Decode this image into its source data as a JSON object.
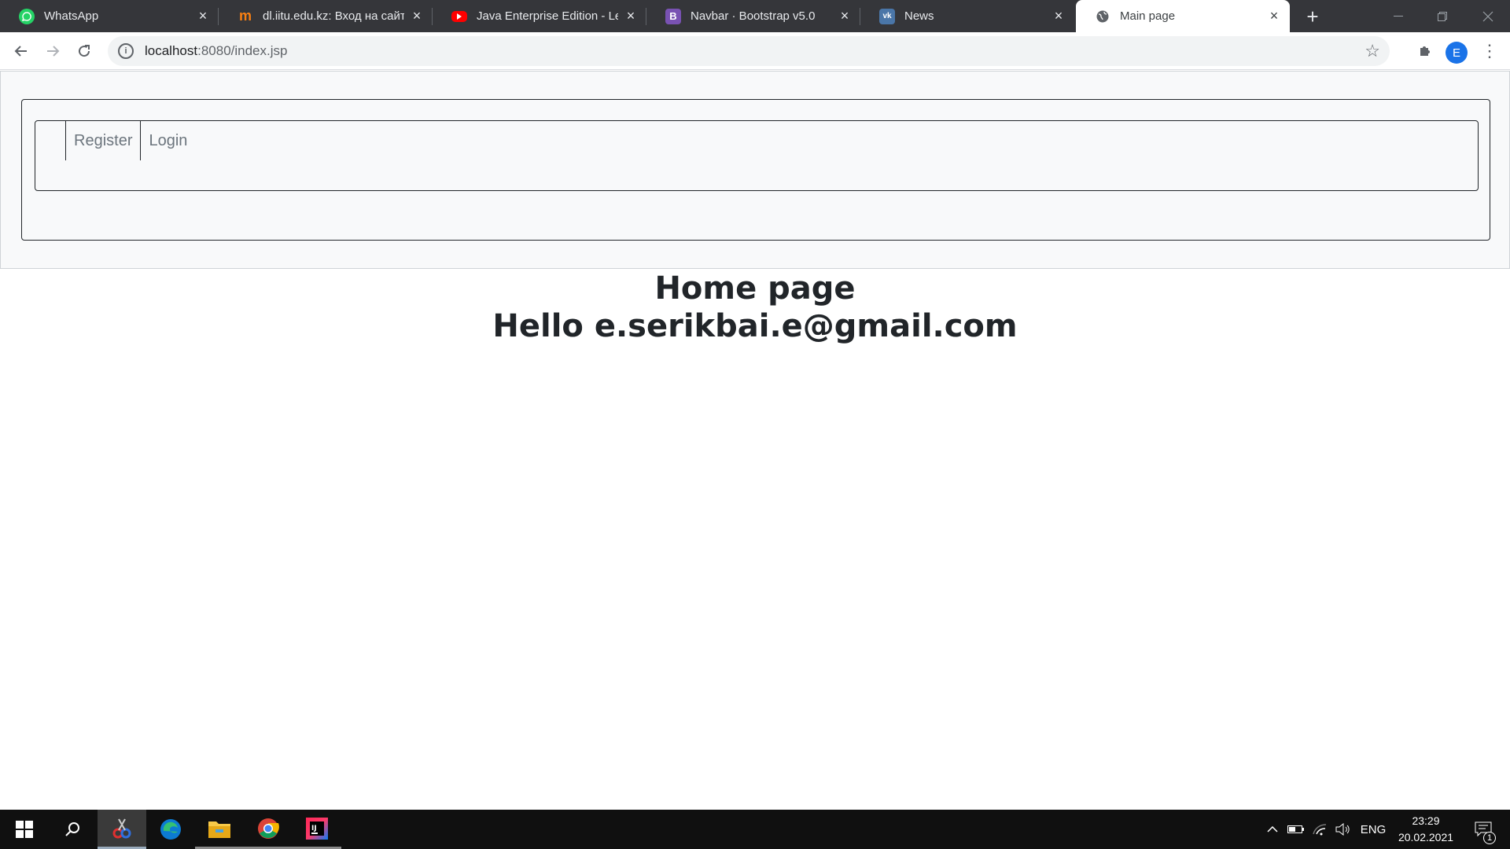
{
  "browser": {
    "tabs": [
      {
        "title": "WhatsApp",
        "icon": "whatsapp-icon",
        "color": "#25d366",
        "active": false
      },
      {
        "title": "dl.iitu.edu.kz: Вход на сайт",
        "icon": "moodle-icon",
        "color": "#f98012",
        "active": false
      },
      {
        "title": "Java Enterprise Edition - Lessons",
        "icon": "youtube-icon",
        "color": "#ff0000",
        "active": false
      },
      {
        "title": "Navbar · Bootstrap v5.0",
        "icon": "bootstrap-icon",
        "color": "#7952b3",
        "active": false
      },
      {
        "title": "News",
        "icon": "vk-icon",
        "color": "#4a76a8",
        "active": false
      },
      {
        "title": "Main page",
        "icon": "globe-icon",
        "color": "#5f6368",
        "active": true
      }
    ],
    "url_host": "localhost",
    "url_path": ":8080/index.jsp",
    "profile_initial": "E"
  },
  "page": {
    "nav_links": [
      "Register",
      "Login"
    ],
    "heading": "Home page",
    "greeting": "Hello e.serikbai.e@gmail.com"
  },
  "taskbar": {
    "apps": [
      "windows-start-icon",
      "search-icon",
      "snipping-tool-icon",
      "edge-icon",
      "file-explorer-icon",
      "chrome-icon",
      "intellij-idea-icon"
    ],
    "language": "ENG",
    "time": "23:29",
    "date": "20.02.2021",
    "notifications": "1"
  },
  "colors": {
    "accent": "#1a73e8",
    "navbar_bg": "#f8f9fa",
    "link_text": "#6c757d",
    "heading_text": "#212529"
  }
}
